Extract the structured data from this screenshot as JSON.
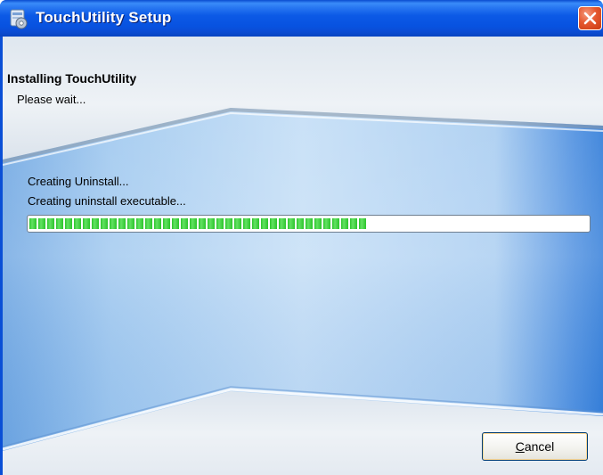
{
  "window": {
    "title": "TouchUtility Setup",
    "close_icon": "close-icon",
    "app_icon": "setup-icon"
  },
  "header": {
    "title": "Installing TouchUtility",
    "subtitle": "Please wait..."
  },
  "status": {
    "action": "Creating Uninstall...",
    "detail": "Creating uninstall executable..."
  },
  "progress": {
    "percent": 61
  },
  "buttons": {
    "cancel_mnemonic": "C",
    "cancel_rest": "ancel"
  },
  "colors": {
    "titlebar": "#0c5ae6",
    "progress_fill": "#2cc42c",
    "close_button": "#e5582f",
    "background_blue": "#7db4ea"
  }
}
